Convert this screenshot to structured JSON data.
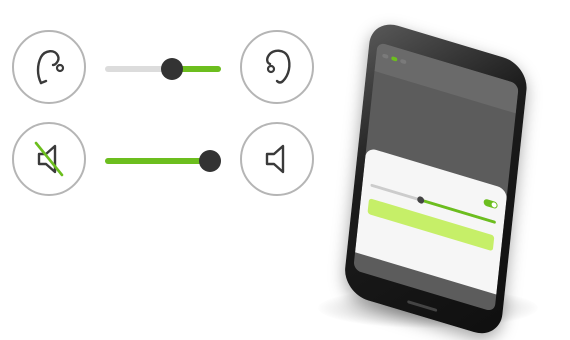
{
  "colors": {
    "accent": "#6cbe1e",
    "knob": "#333333",
    "icon_stroke": "#3a3a3a",
    "circle_border": "#b5b5b5"
  },
  "row1": {
    "left_icon": "behind-the-ear-hearing-aid-icon",
    "right_icon": "in-the-ear-hearing-aid-icon",
    "slider_level": 0.6
  },
  "row2": {
    "left_icon": "speaker-muted-icon",
    "right_icon": "speaker-icon",
    "slider_level": 1.0
  },
  "phone": {
    "status": "",
    "tabs": [
      "",
      "",
      ""
    ],
    "sheet": {
      "title": "",
      "rows": [
        "",
        ""
      ],
      "button_label": ""
    }
  }
}
